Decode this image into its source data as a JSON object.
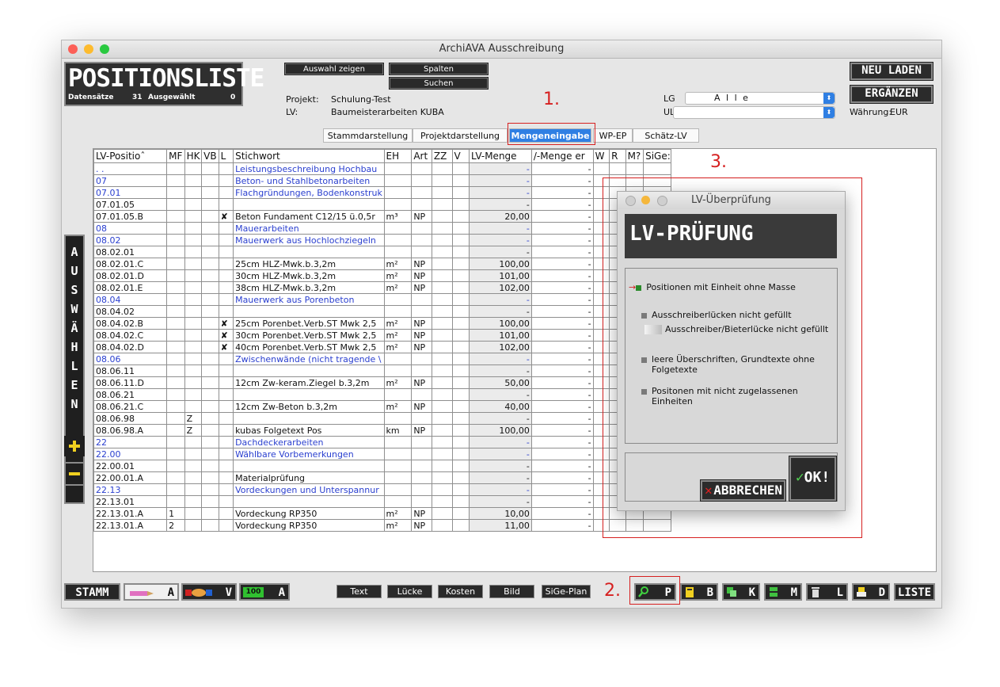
{
  "window": {
    "title": "ArchiAVA Ausschreibung"
  },
  "header": {
    "title": "POSITIONSLISTE",
    "datensaetze_label": "Datensätze",
    "datensaetze_value": "31",
    "ausgewaehlt_label": "Ausgewählt",
    "ausgewaehlt_value": "0",
    "btn_auswahl": "Auswahl zeigen",
    "btn_spalten": "Spalten",
    "btn_suchen": "Suchen",
    "projekt_label": "Projekt:",
    "projekt_value": "Schulung-Test",
    "lv_label": "LV:",
    "lv_value": "Baumeisterarbeiten KUBA",
    "lg_label": "LG",
    "lg_value": "A l l e",
    "ulg_label": "ULG",
    "ulg_value": "",
    "btn_neu_laden": "NEU LADEN",
    "btn_ergaenzen": "ERGÄNZEN",
    "waehrung_label": "Währung:",
    "waehrung_value": "EUR"
  },
  "tabs": [
    "Stammdarstellung",
    "Projektdarstellung",
    "Mengeneingabe",
    "WP-EP",
    "Schätz-LV"
  ],
  "active_tab": "Mengeneingabe",
  "columns": [
    "LV-Positioˆ",
    "MF",
    "HK",
    "VB",
    "L",
    "Stichwort",
    "EH",
    "Art",
    "ZZ",
    "V",
    "LV-Menge",
    "/-Menge er",
    "W",
    "R",
    "M?",
    "SiGe:"
  ],
  "rows": [
    {
      "pos": ". .",
      "mf": "",
      "hk": "",
      "vb": "",
      "l": "",
      "stichwort": "Leistungsbeschreibung Hochbau",
      "eh": "",
      "art": "",
      "lvm": "-",
      "em": "-",
      "blue": true
    },
    {
      "pos": "07",
      "mf": "",
      "hk": "",
      "vb": "",
      "l": "",
      "stichwort": "Beton- und Stahlbetonarbeiten",
      "eh": "",
      "art": "",
      "lvm": "-",
      "em": "-",
      "blue": true
    },
    {
      "pos": "07.01",
      "mf": "",
      "hk": "",
      "vb": "",
      "l": "",
      "stichwort": "Flachgründungen, Bodenkonstruk",
      "eh": "",
      "art": "",
      "lvm": "-",
      "em": "-",
      "blue": true
    },
    {
      "pos": "07.01.05",
      "mf": "",
      "hk": "",
      "vb": "",
      "l": "",
      "stichwort": "",
      "eh": "",
      "art": "",
      "lvm": "-",
      "em": "-",
      "blue": false
    },
    {
      "pos": "07.01.05.B",
      "mf": "",
      "hk": "",
      "vb": "",
      "l": "✘",
      "stichwort": "Beton Fundament C12/15 ü.0,5r",
      "eh": "m³",
      "art": "NP",
      "lvm": "20,00",
      "em": "-",
      "blue": false
    },
    {
      "pos": "08",
      "mf": "",
      "hk": "",
      "vb": "",
      "l": "",
      "stichwort": "Mauerarbeiten",
      "eh": "",
      "art": "",
      "lvm": "-",
      "em": "-",
      "blue": true
    },
    {
      "pos": "08.02",
      "mf": "",
      "hk": "",
      "vb": "",
      "l": "",
      "stichwort": "Mauerwerk aus Hochlochziegeln",
      "eh": "",
      "art": "",
      "lvm": "-",
      "em": "-",
      "blue": true
    },
    {
      "pos": "08.02.01",
      "mf": "",
      "hk": "",
      "vb": "",
      "l": "",
      "stichwort": "",
      "eh": "",
      "art": "",
      "lvm": "-",
      "em": "-",
      "blue": false
    },
    {
      "pos": "08.02.01.C",
      "mf": "",
      "hk": "",
      "vb": "",
      "l": "",
      "stichwort": "25cm HLZ-Mwk.b.3,2m",
      "eh": "m²",
      "art": "NP",
      "lvm": "100,00",
      "em": "-",
      "blue": false
    },
    {
      "pos": "08.02.01.D",
      "mf": "",
      "hk": "",
      "vb": "",
      "l": "",
      "stichwort": "30cm HLZ-Mwk.b.3,2m",
      "eh": "m²",
      "art": "NP",
      "lvm": "101,00",
      "em": "-",
      "blue": false
    },
    {
      "pos": "08.02.01.E",
      "mf": "",
      "hk": "",
      "vb": "",
      "l": "",
      "stichwort": "38cm HLZ-Mwk.b.3,2m",
      "eh": "m²",
      "art": "NP",
      "lvm": "102,00",
      "em": "-",
      "blue": false
    },
    {
      "pos": "08.04",
      "mf": "",
      "hk": "",
      "vb": "",
      "l": "",
      "stichwort": "Mauerwerk aus Porenbeton",
      "eh": "",
      "art": "",
      "lvm": "-",
      "em": "-",
      "blue": true
    },
    {
      "pos": "08.04.02",
      "mf": "",
      "hk": "",
      "vb": "",
      "l": "",
      "stichwort": "",
      "eh": "",
      "art": "",
      "lvm": "-",
      "em": "-",
      "blue": false
    },
    {
      "pos": "08.04.02.B",
      "mf": "",
      "hk": "",
      "vb": "",
      "l": "✘",
      "stichwort": "25cm Porenbet.Verb.ST Mwk 2,5",
      "eh": "m²",
      "art": "NP",
      "lvm": "100,00",
      "em": "-",
      "blue": false
    },
    {
      "pos": "08.04.02.C",
      "mf": "",
      "hk": "",
      "vb": "",
      "l": "✘",
      "stichwort": "30cm Porenbet.Verb.ST Mwk 2,5",
      "eh": "m²",
      "art": "NP",
      "lvm": "101,00",
      "em": "-",
      "blue": false
    },
    {
      "pos": "08.04.02.D",
      "mf": "",
      "hk": "",
      "vb": "",
      "l": "✘",
      "stichwort": "40cm Porenbet.Verb.ST Mwk 2,5",
      "eh": "m²",
      "art": "NP",
      "lvm": "102,00",
      "em": "-",
      "blue": false
    },
    {
      "pos": "08.06",
      "mf": "",
      "hk": "",
      "vb": "",
      "l": "",
      "stichwort": "Zwischenwände (nicht tragende \\",
      "eh": "",
      "art": "",
      "lvm": "-",
      "em": "-",
      "blue": true
    },
    {
      "pos": "08.06.11",
      "mf": "",
      "hk": "",
      "vb": "",
      "l": "",
      "stichwort": "",
      "eh": "",
      "art": "",
      "lvm": "-",
      "em": "-",
      "blue": false
    },
    {
      "pos": "08.06.11.D",
      "mf": "",
      "hk": "",
      "vb": "",
      "l": "",
      "stichwort": "12cm Zw-keram.Ziegel b.3,2m",
      "eh": "m²",
      "art": "NP",
      "lvm": "50,00",
      "em": "-",
      "blue": false
    },
    {
      "pos": "08.06.21",
      "mf": "",
      "hk": "",
      "vb": "",
      "l": "",
      "stichwort": "",
      "eh": "",
      "art": "",
      "lvm": "-",
      "em": "-",
      "blue": false
    },
    {
      "pos": "08.06.21.C",
      "mf": "",
      "hk": "",
      "vb": "",
      "l": "",
      "stichwort": "12cm Zw-Beton b.3,2m",
      "eh": "m²",
      "art": "NP",
      "lvm": "40,00",
      "em": "-",
      "blue": false
    },
    {
      "pos": "08.06.98",
      "mf": "",
      "hk": "Z",
      "vb": "",
      "l": "",
      "stichwort": "",
      "eh": "",
      "art": "",
      "lvm": "-",
      "em": "-",
      "blue": false
    },
    {
      "pos": "08.06.98.A",
      "mf": "",
      "hk": "Z",
      "vb": "",
      "l": "",
      "stichwort": "kubas Folgetext Pos",
      "eh": "km",
      "art": "NP",
      "lvm": "100,00",
      "em": "-",
      "blue": false
    },
    {
      "pos": "22",
      "mf": "",
      "hk": "",
      "vb": "",
      "l": "",
      "stichwort": "Dachdeckerarbeiten",
      "eh": "",
      "art": "",
      "lvm": "-",
      "em": "-",
      "blue": true
    },
    {
      "pos": "22.00",
      "mf": "",
      "hk": "",
      "vb": "",
      "l": "",
      "stichwort": "Wählbare Vorbemerkungen",
      "eh": "",
      "art": "",
      "lvm": "-",
      "em": "-",
      "blue": true
    },
    {
      "pos": "22.00.01",
      "mf": "",
      "hk": "",
      "vb": "",
      "l": "",
      "stichwort": "",
      "eh": "",
      "art": "",
      "lvm": "-",
      "em": "-",
      "blue": false
    },
    {
      "pos": "22.00.01.A",
      "mf": "",
      "hk": "",
      "vb": "",
      "l": "",
      "stichwort": "Materialprüfung",
      "eh": "",
      "art": "",
      "lvm": "-",
      "em": "-",
      "blue": false
    },
    {
      "pos": "22.13",
      "mf": "",
      "hk": "",
      "vb": "",
      "l": "",
      "stichwort": "Vordeckungen und Unterspannur",
      "eh": "",
      "art": "",
      "lvm": "-",
      "em": "-",
      "blue": true
    },
    {
      "pos": "22.13.01",
      "mf": "",
      "hk": "",
      "vb": "",
      "l": "",
      "stichwort": "",
      "eh": "",
      "art": "",
      "lvm": "-",
      "em": "-",
      "blue": false
    },
    {
      "pos": "22.13.01.A",
      "mf": "1",
      "hk": "",
      "vb": "",
      "l": "",
      "stichwort": "Vordeckung RP350",
      "eh": "m²",
      "art": "NP",
      "lvm": "10,00",
      "em": "-",
      "blue": false
    },
    {
      "pos": "22.13.01.A",
      "mf": "2",
      "hk": "",
      "vb": "",
      "l": "",
      "stichwort": "Vordeckung RP350",
      "eh": "m²",
      "art": "NP",
      "lvm": "11,00",
      "em": "-",
      "blue": false
    }
  ],
  "leftbar": [
    "A",
    "U",
    "S",
    "W",
    "Ä",
    "H",
    "L",
    "E",
    "N"
  ],
  "bottom": {
    "stamm": "STAMM",
    "a": "A",
    "v": "V",
    "a2": "A",
    "a2_icon_text": "100",
    "text": "Text",
    "luecke": "Lücke",
    "kosten": "Kosten",
    "bild": "Bild",
    "sige": "SiGe-Plan",
    "p": "P",
    "b": "B",
    "k": "K",
    "m": "M",
    "l": "L",
    "d": "D",
    "liste": "LISTE"
  },
  "annotations": {
    "one": "1.",
    "two": "2.",
    "three": "3."
  },
  "dialog": {
    "title": "LV-Überprüfung",
    "banner": "LV-PRÜFUNG",
    "opt1": "Positionen mit Einheit ohne Masse",
    "opt2": "Ausschreiberlücken nicht gefüllt",
    "opt2b": "Ausschreiber/Bieterlücke nicht gefüllt",
    "opt3": "leere Überschriften, Grundtexte ohne Folgetexte",
    "opt4": "Positonen mit nicht zugelassenen Einheiten",
    "cancel": "ABBRECHEN",
    "ok": "OK!"
  },
  "colors": {
    "accent": "#2f7fe3",
    "annotation": "#d62020",
    "link_text": "#2a3fcf"
  }
}
